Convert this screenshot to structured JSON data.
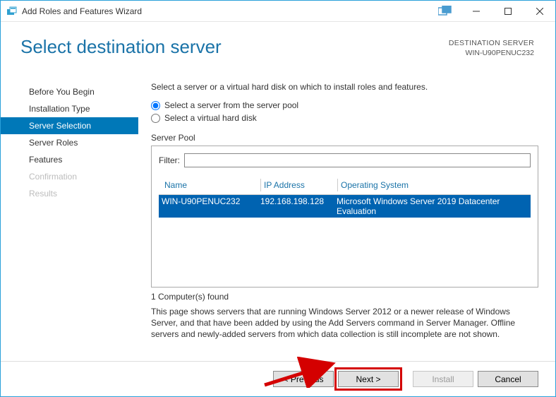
{
  "window": {
    "title": "Add Roles and Features Wizard"
  },
  "header": {
    "title": "Select destination server",
    "dest_label": "DESTINATION SERVER",
    "dest_name": "WIN-U90PENUC232"
  },
  "sidebar": {
    "items": [
      {
        "label": "Before You Begin",
        "state": "normal"
      },
      {
        "label": "Installation Type",
        "state": "normal"
      },
      {
        "label": "Server Selection",
        "state": "active"
      },
      {
        "label": "Server Roles",
        "state": "normal"
      },
      {
        "label": "Features",
        "state": "normal"
      },
      {
        "label": "Confirmation",
        "state": "disabled"
      },
      {
        "label": "Results",
        "state": "disabled"
      }
    ]
  },
  "main": {
    "instruction": "Select a server or a virtual hard disk on which to install roles and features.",
    "radio1_label": "Select a server from the server pool",
    "radio2_label": "Select a virtual hard disk",
    "group_label": "Server Pool",
    "filter_label": "Filter:",
    "filter_value": "",
    "columns": {
      "name": "Name",
      "ip": "IP Address",
      "os": "Operating System"
    },
    "rows": [
      {
        "name": "WIN-U90PENUC232",
        "ip": "192.168.198.128",
        "os": "Microsoft Windows Server 2019 Datacenter Evaluation"
      }
    ],
    "found": "1 Computer(s) found",
    "note": "This page shows servers that are running Windows Server 2012 or a newer release of Windows Server, and that have been added by using the Add Servers command in Server Manager. Offline servers and newly-added servers from which data collection is still incomplete are not shown."
  },
  "footer": {
    "previous": "< Previous",
    "next": "Next >",
    "install": "Install",
    "cancel": "Cancel"
  }
}
